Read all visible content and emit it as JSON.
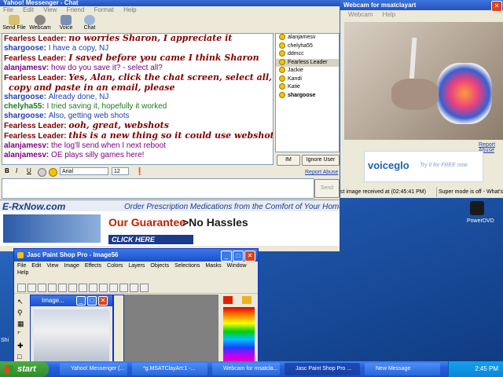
{
  "chat": {
    "title": "Yahoo! Messenger - Chat",
    "menu": [
      "File",
      "Edit",
      "View",
      "Friend",
      "Format",
      "Help"
    ],
    "toolbar": [
      "Send File",
      "Webcam",
      "Voice",
      "Chat"
    ],
    "messages": [
      {
        "who": "Fearless Leader:",
        "text": "no worries Sharon, I appreciate it",
        "style": "fancy",
        "color": "#800000"
      },
      {
        "who": "shargoose:",
        "text": "I have a copy, NJ",
        "style": "plain",
        "color": "#1f3fb5"
      },
      {
        "who": "Fearless Leader:",
        "text": "I saved before you came I think Sharon",
        "style": "fancy",
        "color": "#800000"
      },
      {
        "who": "alanjamesv:",
        "text": "how do you save it? - select all?",
        "style": "plain",
        "color": "#800080"
      },
      {
        "who": "Fearless Leader:",
        "text": "Yes, Alan, click the chat screen, select all,",
        "style": "fancy",
        "color": "#800000"
      },
      {
        "who": "",
        "text": "copy and paste in an email, please",
        "style": "fancy",
        "color": "#800000"
      },
      {
        "who": "shargoose:",
        "text": "Already done, NJ",
        "style": "plain",
        "color": "#1f3fb5"
      },
      {
        "who": "chelyha55:",
        "text": "I tried saving it, hopefully it worked",
        "style": "plain",
        "color": "#1f7a1f"
      },
      {
        "who": "shargoose:",
        "text": "Also, getting web shots",
        "style": "plain",
        "color": "#1f3fb5"
      },
      {
        "who": "Fearless Leader:",
        "text": "ooh, great, webshots",
        "style": "fancy",
        "color": "#800000"
      },
      {
        "who": "Fearless Leader:",
        "text": "this is a new thing so it could use webshots",
        "style": "fancy",
        "color": "#800000"
      },
      {
        "who": "alanjamesv:",
        "text": "the log'll send when I next reboot",
        "style": "plain",
        "color": "#800080"
      },
      {
        "who": "alanjamesv:",
        "text": "OE plays silly games here!",
        "style": "plain",
        "color": "#800080"
      }
    ],
    "users": [
      "alanjamesv",
      "chelyha55",
      "ddmcc",
      "Fearless Leader",
      "Jackie",
      "Kandi",
      "Katie",
      "shargoose"
    ],
    "im_button": "IM",
    "ignore_button": "Ignore User",
    "report_abuse": "Report Abuse",
    "format": {
      "bold": "B",
      "italic": "I",
      "underline": "U",
      "font": "Arial",
      "size": "12"
    },
    "send_button": "Send"
  },
  "ad": {
    "brand": "E-RxNow.com",
    "headline": "Order Prescription Medications from the Comfort of Your Home",
    "guarantee": "Our Guarantee",
    "arrow_text": ">No Hassles",
    "cta": "CLICK HERE"
  },
  "webcam": {
    "title": "Webcam for msatclayart",
    "menu": [
      "Webcam",
      "Help"
    ],
    "report_abuse": "Report Abuse",
    "voiceglo": "voiceglo",
    "voiceglo_tag": "Try it for FREE now.",
    "status_left": "st image received at (02:45:41 PM)",
    "status_right": "Super mode is off - What's th"
  },
  "psp": {
    "title": "Jasc Paint Shop Pro - Image56",
    "menu": [
      "File",
      "Edit",
      "View",
      "Image",
      "Effects",
      "Colors",
      "Layers",
      "Objects",
      "Selections",
      "Masks",
      "Window",
      "Help"
    ],
    "image_title": "Image..."
  },
  "desktop": {
    "icon_label": "PowerDVD",
    "left_label": "Shi"
  },
  "taskbar": {
    "start": "start",
    "tasks": [
      "Yahoo! Messenger (...",
      "*g.MSATClayArt:1 -...",
      "Webcam for msatcla...",
      "Jasc Paint Shop Pro ...",
      "New Message"
    ],
    "clock": "2:45 PM"
  }
}
